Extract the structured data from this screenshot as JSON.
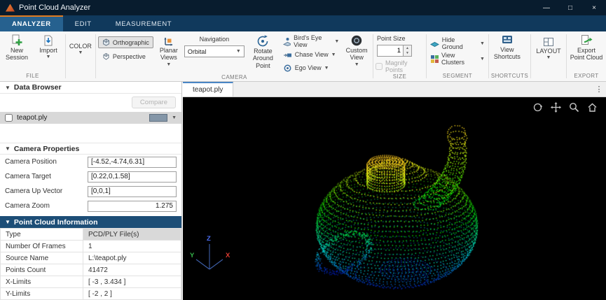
{
  "window": {
    "title": "Point Cloud Analyzer",
    "minimize": "—",
    "maximize": "□",
    "close": "×"
  },
  "ribbon_tabs": [
    {
      "label": "ANALYZER"
    },
    {
      "label": "EDIT"
    },
    {
      "label": "MEASUREMENT"
    }
  ],
  "ribbon": {
    "file": {
      "label": "FILE",
      "new_session": "New Session",
      "import": "Import"
    },
    "color": {
      "button": "COLOR"
    },
    "camera": {
      "label": "CAMERA",
      "orthographic": "Orthographic",
      "perspective": "Perspective",
      "planar_views": "Planar Views",
      "navigation": "Navigation",
      "navigation_value": "Orbital",
      "rotate": "Rotate Around Point"
    },
    "views": {
      "birds_eye": "Bird's Eye View",
      "chase": "Chase View",
      "ego": "Ego View",
      "custom": "Custom View"
    },
    "size": {
      "label": "SIZE",
      "point_size": "Point Size",
      "value": "1",
      "magnify": "Magnify Points"
    },
    "segment": {
      "label": "SEGMENT",
      "hide_ground": "Hide Ground",
      "view_clusters": "View Clusters"
    },
    "shortcuts": {
      "label": "SHORTCUTS",
      "view_shortcuts": "View Shortcuts"
    },
    "layout": {
      "button": "LAYOUT"
    },
    "export": {
      "label": "EXPORT",
      "export_point_cloud": "Export Point Cloud"
    }
  },
  "data_browser": {
    "title": "Data Browser",
    "compare": "Compare",
    "file": "teapot.ply"
  },
  "camera_properties": {
    "title": "Camera Properties",
    "rows": [
      {
        "label": "Camera Position",
        "value": "[-4.52,-4.74,6.31]"
      },
      {
        "label": "Camera Target",
        "value": "[0.22,0,1.58]"
      },
      {
        "label": "Camera Up Vector",
        "value": "[0,0,1]"
      },
      {
        "label": "Camera Zoom",
        "value": "1.275"
      }
    ]
  },
  "point_cloud_info": {
    "title": "Point Cloud Information",
    "rows": [
      {
        "label": "Type",
        "value": "PCD/PLY File(s)"
      },
      {
        "label": "Number Of Frames",
        "value": "1"
      },
      {
        "label": "Source Name",
        "value": "L:\\teapot.ply"
      },
      {
        "label": "Points Count",
        "value": "41472"
      },
      {
        "label": "X-Limits",
        "value": "[ -3 , 3.434 ]"
      },
      {
        "label": "Y-Limits",
        "value": "[ -2 , 2 ]"
      }
    ]
  },
  "viewer": {
    "tab": "teapot.ply",
    "menu": "⋮",
    "axes": {
      "x": "X",
      "y": "Y",
      "z": "Z"
    }
  }
}
